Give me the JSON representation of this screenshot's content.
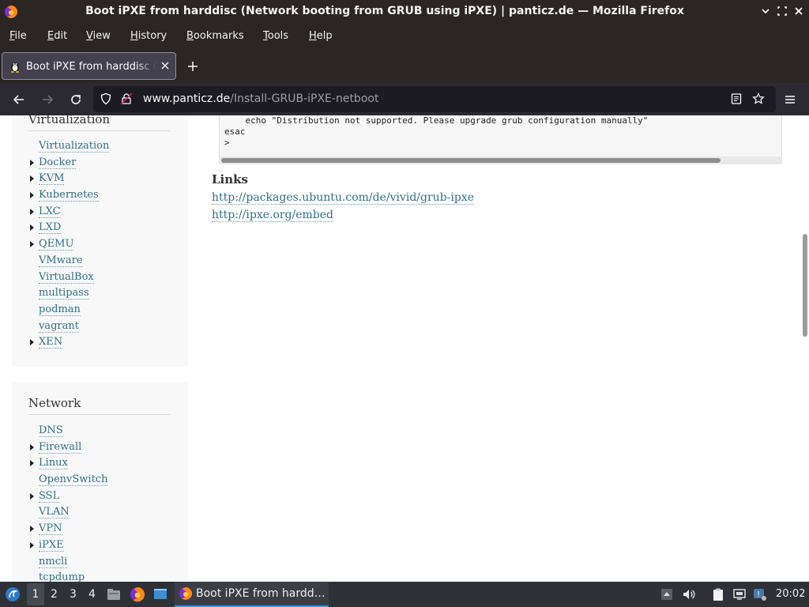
{
  "window": {
    "title": "Boot iPXE from harddisc (Network booting from GRUB using iPXE) | panticz.de — Mozilla Firefox"
  },
  "menu": [
    "File",
    "Edit",
    "View",
    "History",
    "Bookmarks",
    "Tools",
    "Help"
  ],
  "tab": {
    "title": "Boot iPXE from harddisc (Network booting from GRUB using iPXE) | panticz.de"
  },
  "urlbar": {
    "host": "www.panticz.de",
    "path": "/Install-GRUB-iPXE-netboot"
  },
  "sidebar": {
    "virtualization": {
      "title": "Virtualization",
      "items": [
        {
          "label": "Virtualization",
          "expandable": false
        },
        {
          "label": "Docker",
          "expandable": true
        },
        {
          "label": "KVM",
          "expandable": true
        },
        {
          "label": "Kubernetes",
          "expandable": true
        },
        {
          "label": "LXC",
          "expandable": true
        },
        {
          "label": "LXD",
          "expandable": true
        },
        {
          "label": "QEMU",
          "expandable": true
        },
        {
          "label": "VMware",
          "expandable": false
        },
        {
          "label": "VirtualBox",
          "expandable": false
        },
        {
          "label": "multipass",
          "expandable": false
        },
        {
          "label": "podman",
          "expandable": false
        },
        {
          "label": "vagrant",
          "expandable": false
        },
        {
          "label": "XEN",
          "expandable": true
        }
      ]
    },
    "network": {
      "title": "Network",
      "items": [
        {
          "label": "DNS",
          "expandable": false
        },
        {
          "label": "Firewall",
          "expandable": true
        },
        {
          "label": "Linux",
          "expandable": true
        },
        {
          "label": "OpenvSwitch",
          "expandable": false
        },
        {
          "label": "SSL",
          "expandable": true
        },
        {
          "label": "VLAN",
          "expandable": false
        },
        {
          "label": "VPN",
          "expandable": true
        },
        {
          "label": "iPXE",
          "expandable": true
        },
        {
          "label": "nmcli",
          "expandable": false
        },
        {
          "label": "tcpdump",
          "expandable": false
        }
      ]
    }
  },
  "code": {
    "lines": [
      "    echo \"Distribution not supported. Please upgrade grub configuration manually\"",
      "esac",
      ">"
    ]
  },
  "links": {
    "heading": "Links",
    "items": [
      "http://packages.ubuntu.com/de/vivid/grub-ipxe",
      "http://ipxe.org/embed"
    ]
  },
  "taskbar": {
    "workspaces": [
      "1",
      "2",
      "3",
      "4"
    ],
    "active_window": "Boot iPXE from hardd…",
    "clock": "20:02"
  }
}
